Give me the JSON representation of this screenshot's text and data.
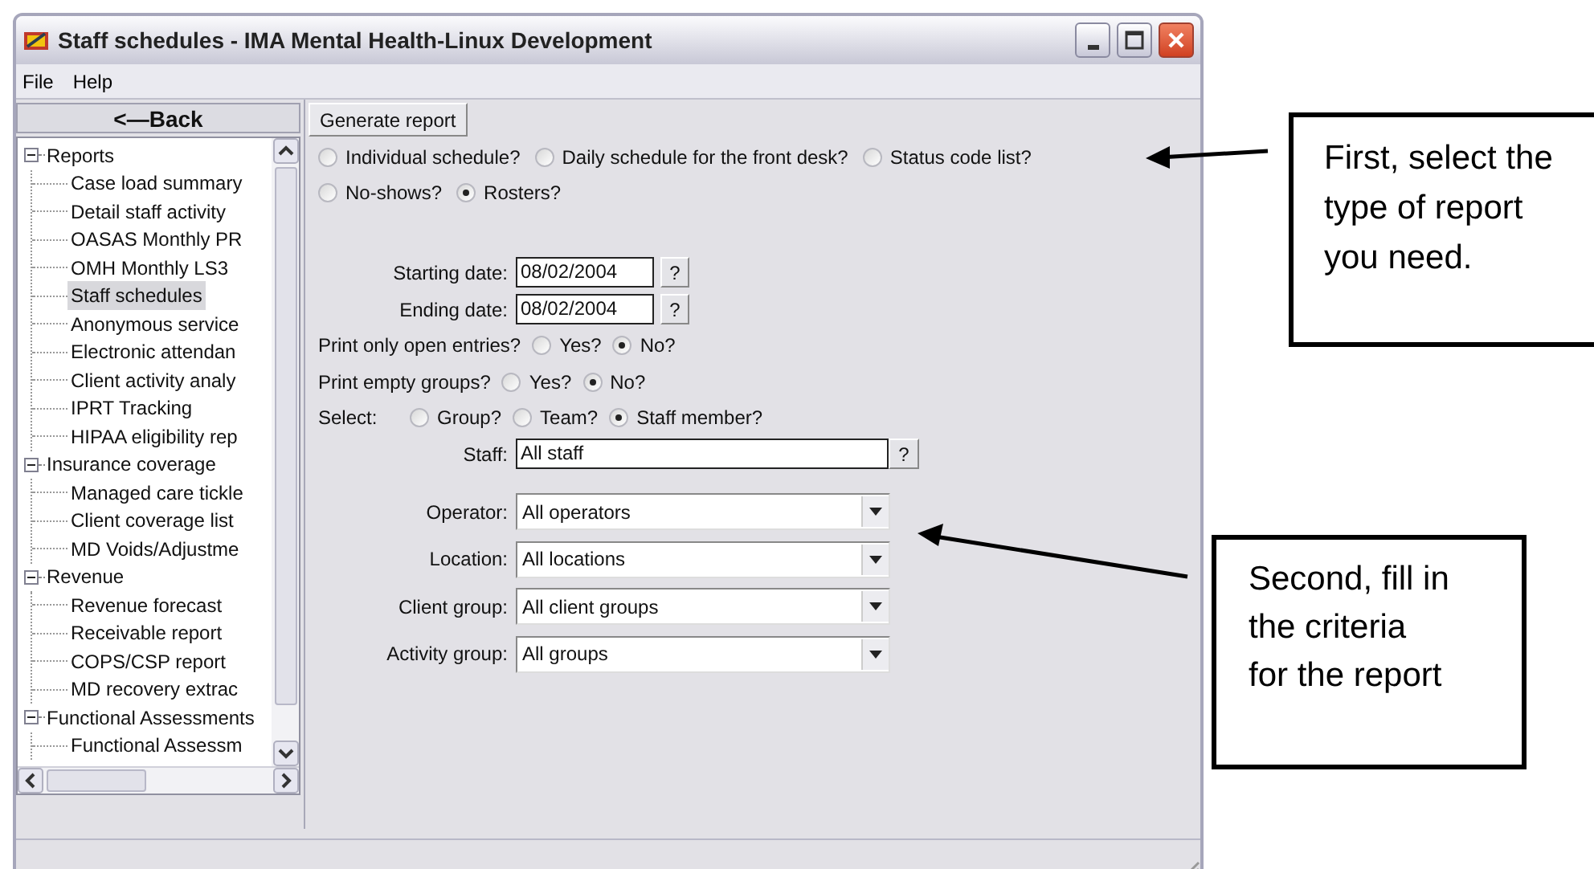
{
  "window": {
    "title": "Staff schedules - IMA Mental Health-Linux Development"
  },
  "menu": [
    "File",
    "Help"
  ],
  "back_button": "<—Back",
  "tree": [
    {
      "label": "Reports",
      "expanded": true,
      "selected": false,
      "children": [
        {
          "label": "Case load summary",
          "selected": false
        },
        {
          "label": "Detail staff activity",
          "selected": false
        },
        {
          "label": "OASAS Monthly PR",
          "selected": false
        },
        {
          "label": "OMH Monthly LS3",
          "selected": false
        },
        {
          "label": "Staff schedules",
          "selected": true
        },
        {
          "label": "Anonymous service",
          "selected": false
        },
        {
          "label": "Electronic attendan",
          "selected": false
        },
        {
          "label": "Client activity analy",
          "selected": false
        },
        {
          "label": "IPRT Tracking",
          "selected": false
        },
        {
          "label": "HIPAA eligibility rep",
          "selected": false
        }
      ]
    },
    {
      "label": "Insurance coverage",
      "expanded": true,
      "selected": false,
      "children": [
        {
          "label": "Managed care tickle",
          "selected": false
        },
        {
          "label": "Client coverage list",
          "selected": false
        },
        {
          "label": "MD Voids/Adjustme",
          "selected": false
        }
      ]
    },
    {
      "label": "Revenue",
      "expanded": true,
      "selected": false,
      "children": [
        {
          "label": "Revenue forecast",
          "selected": false
        },
        {
          "label": "Receivable report",
          "selected": false
        },
        {
          "label": "COPS/CSP report",
          "selected": false
        },
        {
          "label": "MD recovery extrac",
          "selected": false
        }
      ]
    },
    {
      "label": "Functional Assessments",
      "expanded": true,
      "selected": false,
      "children": [
        {
          "label": "Functional Assessm",
          "selected": false
        }
      ]
    }
  ],
  "generate_button": "Generate report",
  "report_type_rows": [
    {
      "options": [
        {
          "label": "Individual schedule?",
          "selected": false
        },
        {
          "label": "Daily schedule for the front desk?",
          "selected": false
        },
        {
          "label": "Status code list?",
          "selected": false
        }
      ]
    },
    {
      "options": [
        {
          "label": "No-shows?",
          "selected": false
        },
        {
          "label": "Rosters?",
          "selected": true
        }
      ]
    }
  ],
  "dates": [
    {
      "label": "Starting date:",
      "value": "08/02/2004",
      "button": "?"
    },
    {
      "label": "Ending date:",
      "value": "08/02/2004",
      "button": "?"
    }
  ],
  "radio_groups": [
    {
      "label": "Print only open entries?",
      "options": [
        {
          "label": "Yes?",
          "selected": false
        },
        {
          "label": "No?",
          "selected": true
        }
      ]
    },
    {
      "label": "Print empty groups?",
      "options": [
        {
          "label": "Yes?",
          "selected": false
        },
        {
          "label": "No?",
          "selected": true
        }
      ]
    },
    {
      "label": "Select:",
      "options": [
        {
          "label": "Group?",
          "selected": false
        },
        {
          "label": "Team?",
          "selected": false
        },
        {
          "label": "Staff member?",
          "selected": true
        }
      ]
    }
  ],
  "staff": {
    "label": "Staff:",
    "value": "All staff",
    "button": "?"
  },
  "dropdowns": [
    {
      "label": "Operator:",
      "value": "All operators"
    },
    {
      "label": "Location:",
      "value": "All locations"
    },
    {
      "label": "Client group:",
      "value": "All client groups"
    },
    {
      "label": "Activity group:",
      "value": "All groups"
    }
  ],
  "callouts": [
    {
      "text": "First, select the type of report you need."
    },
    {
      "text": "Second, fill in the criteria for the report"
    }
  ]
}
